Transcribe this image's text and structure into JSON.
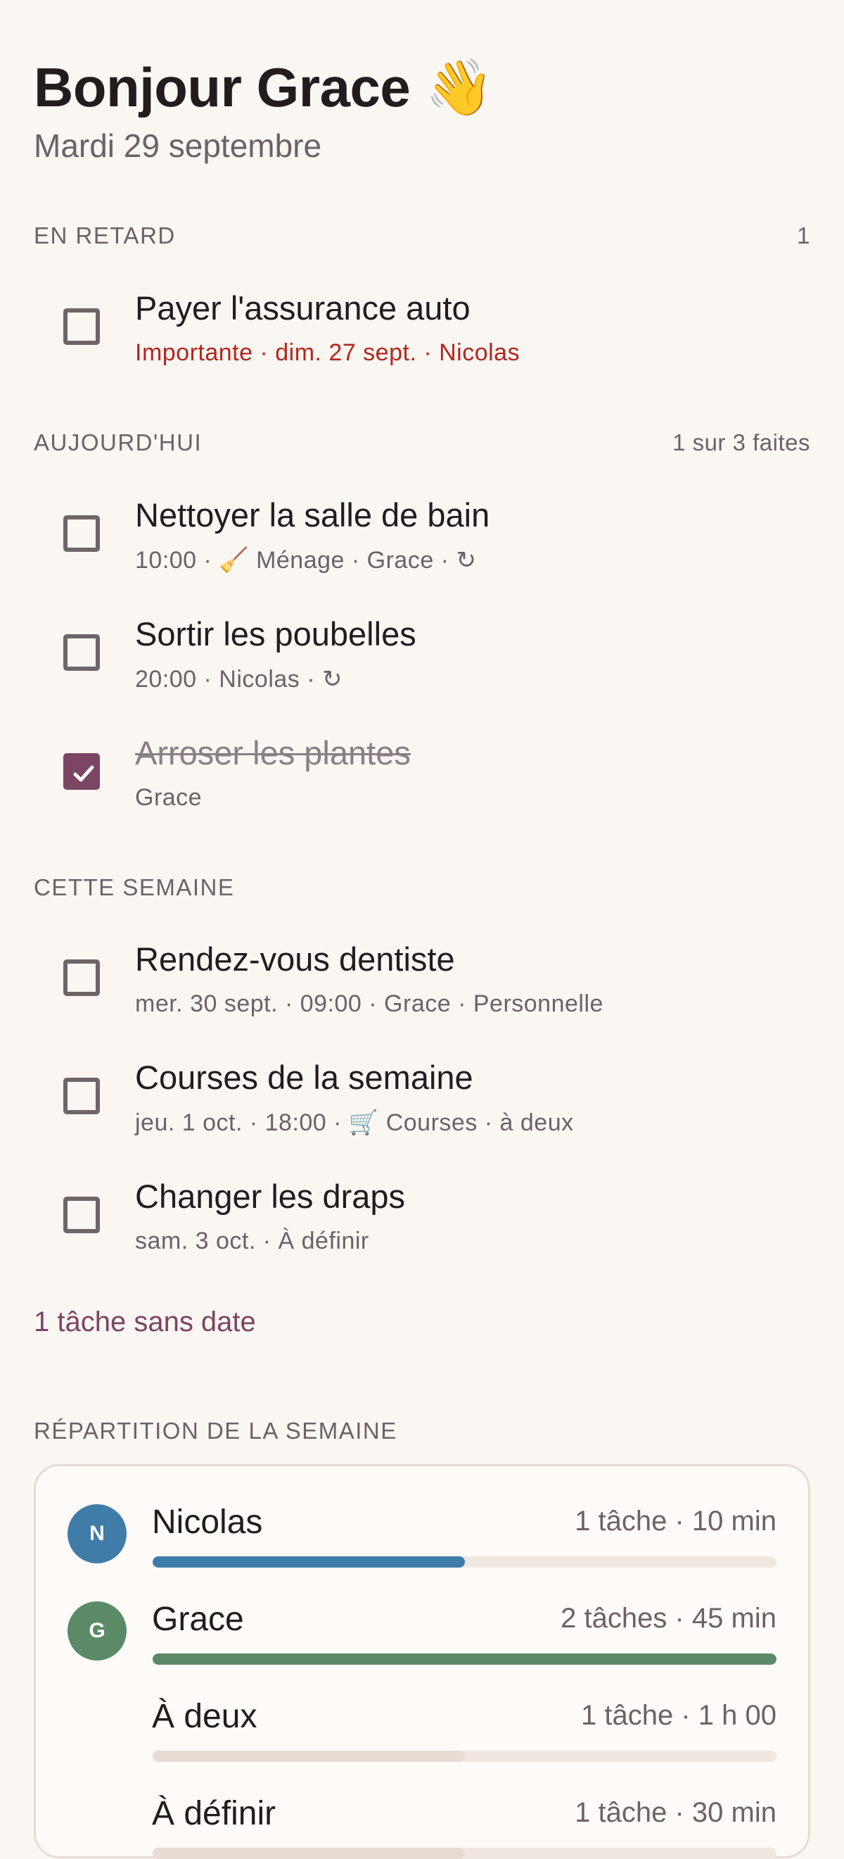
{
  "header": {
    "greeting": "Bonjour Grace 👋",
    "date": "Mardi 29 septembre"
  },
  "sections": {
    "overdue": {
      "title": "EN RETARD",
      "count": "1"
    },
    "today": {
      "title": "AUJOURD'HUI",
      "count": "1 sur 3 faites"
    },
    "week": {
      "title": "CETTE SEMAINE"
    },
    "distribution": {
      "title": "RÉPARTITION DE LA SEMAINE"
    }
  },
  "tasks": [
    {
      "title": "Payer l'assurance auto",
      "meta": "Importante · dim. 27 sept. · Nicolas",
      "done": false
    },
    {
      "title": "Nettoyer la salle de bain",
      "meta": "10:00 · 🧹 Ménage · Grace · ↻",
      "done": false
    },
    {
      "title": "Sortir les poubelles",
      "meta": "20:00 · Nicolas · ↻",
      "done": false
    },
    {
      "title": "Arroser les plantes",
      "meta": "Grace",
      "done": true
    },
    {
      "title": "Rendez-vous dentiste",
      "meta": "mer. 30 sept. · 09:00 · Grace · Personnelle",
      "done": false
    },
    {
      "title": "Courses de la semaine",
      "meta": "jeu. 1 oct. · 18:00 · 🛒 Courses · à deux",
      "done": false
    },
    {
      "title": "Changer les draps",
      "meta": "sam. 3 oct. · À définir",
      "done": false
    }
  ],
  "undated_link": "1 tâche sans date",
  "distribution": [
    {
      "initial": "N",
      "name": "Nicolas",
      "stats": "1 tâche · 10 min",
      "fraction": 0.5,
      "color": "#3f7ca8"
    },
    {
      "initial": "G",
      "name": "Grace",
      "stats": "2 tâches · 45 min",
      "fraction": 1.0,
      "color": "#5b8a66"
    },
    {
      "initial": "",
      "name": "À deux",
      "stats": "1 tâche · 1 h 00",
      "fraction": 0.5,
      "color": "#e8dbd3"
    },
    {
      "initial": "",
      "name": "À définir",
      "stats": "1 tâche · 30 min",
      "fraction": 0.5,
      "color": "#e8dbd3"
    }
  ]
}
